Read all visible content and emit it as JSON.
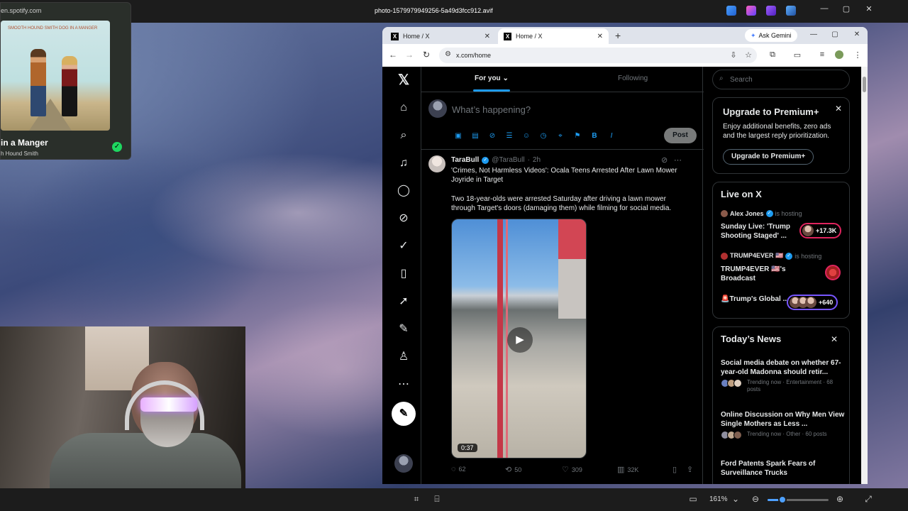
{
  "viewer": {
    "title": "photo-1579979949256-5a49d3fcc912.avif",
    "zoom": "161%",
    "zoom_level": 0.24,
    "window_controls": [
      "—",
      "▢",
      "✕"
    ]
  },
  "spotify": {
    "url": "en.spotify.com",
    "album_text": "SMOOTH HOUND SMITH  DOG IN A MANGER",
    "song": "in a Manger",
    "artist": "h Hound Smith"
  },
  "browser": {
    "tabs": [
      {
        "label": "Home / X"
      },
      {
        "label": "Home / X"
      }
    ],
    "new_tab": "+",
    "ask_gemini": "Ask Gemini",
    "url": "x.com/home",
    "window_controls": [
      "—",
      "▢",
      "✕"
    ]
  },
  "x": {
    "nav_icons": [
      "x-logo-icon",
      "home-icon",
      "search-icon",
      "bell-icon",
      "message-icon",
      "grok-icon",
      "verified-icon",
      "bookmark-icon",
      "rocket-icon",
      "edit-icon",
      "profile-icon",
      "more-icon"
    ],
    "feed_tabs": {
      "for_you": "For you",
      "following": "Following"
    },
    "compose": {
      "placeholder": "What’s happening?",
      "post": "Post"
    },
    "tweet": {
      "name": "TaraBull",
      "handle": "@TaraBull",
      "time": "2h",
      "title": "'Crimes, Not Harmless Videos': Ocala Teens Arrested After Lawn Mower Joyride in Target",
      "body": "Two 18-year-olds were arrested Saturday after driving a lawn mower through Target's doors (damaging them) while filming for social media.",
      "duration": "0:37",
      "replies": "62",
      "reposts": "50",
      "likes": "309",
      "views": "32K"
    },
    "search_placeholder": "Search",
    "premium": {
      "title": "Upgrade to Premium+",
      "desc": "Enjoy additional benefits, zero ads and the largest reply prioritization.",
      "button": "Upgrade to Premium+"
    },
    "live": {
      "title": "Live on X",
      "items": [
        {
          "host": "Alex Jones",
          "status": "is hosting",
          "title": "Sunday Live: 'Trump Shooting Staged' ...",
          "count": "+17.3K"
        },
        {
          "host": "TRUMP4EVER 🇺🇸",
          "status": "is hosting",
          "title": "TRUMP4EVER 🇺🇸's Broadcast",
          "count": ""
        },
        {
          "host": "",
          "status": "",
          "title": "🚨Trump's Global ...",
          "count": "+640"
        }
      ]
    },
    "news": {
      "title": "Today’s News",
      "items": [
        {
          "headline": "Social media debate on whether 67-year-old Madonna should retir...",
          "meta": "Trending now · Entertainment · 68 posts"
        },
        {
          "headline": "Online Discussion on Why Men View Single Mothers as Less ...",
          "meta": "Trending now · Other · 60 posts"
        },
        {
          "headline": "Ford Patents Spark Fears of Surveillance Trucks",
          "meta": ""
        }
      ]
    }
  }
}
